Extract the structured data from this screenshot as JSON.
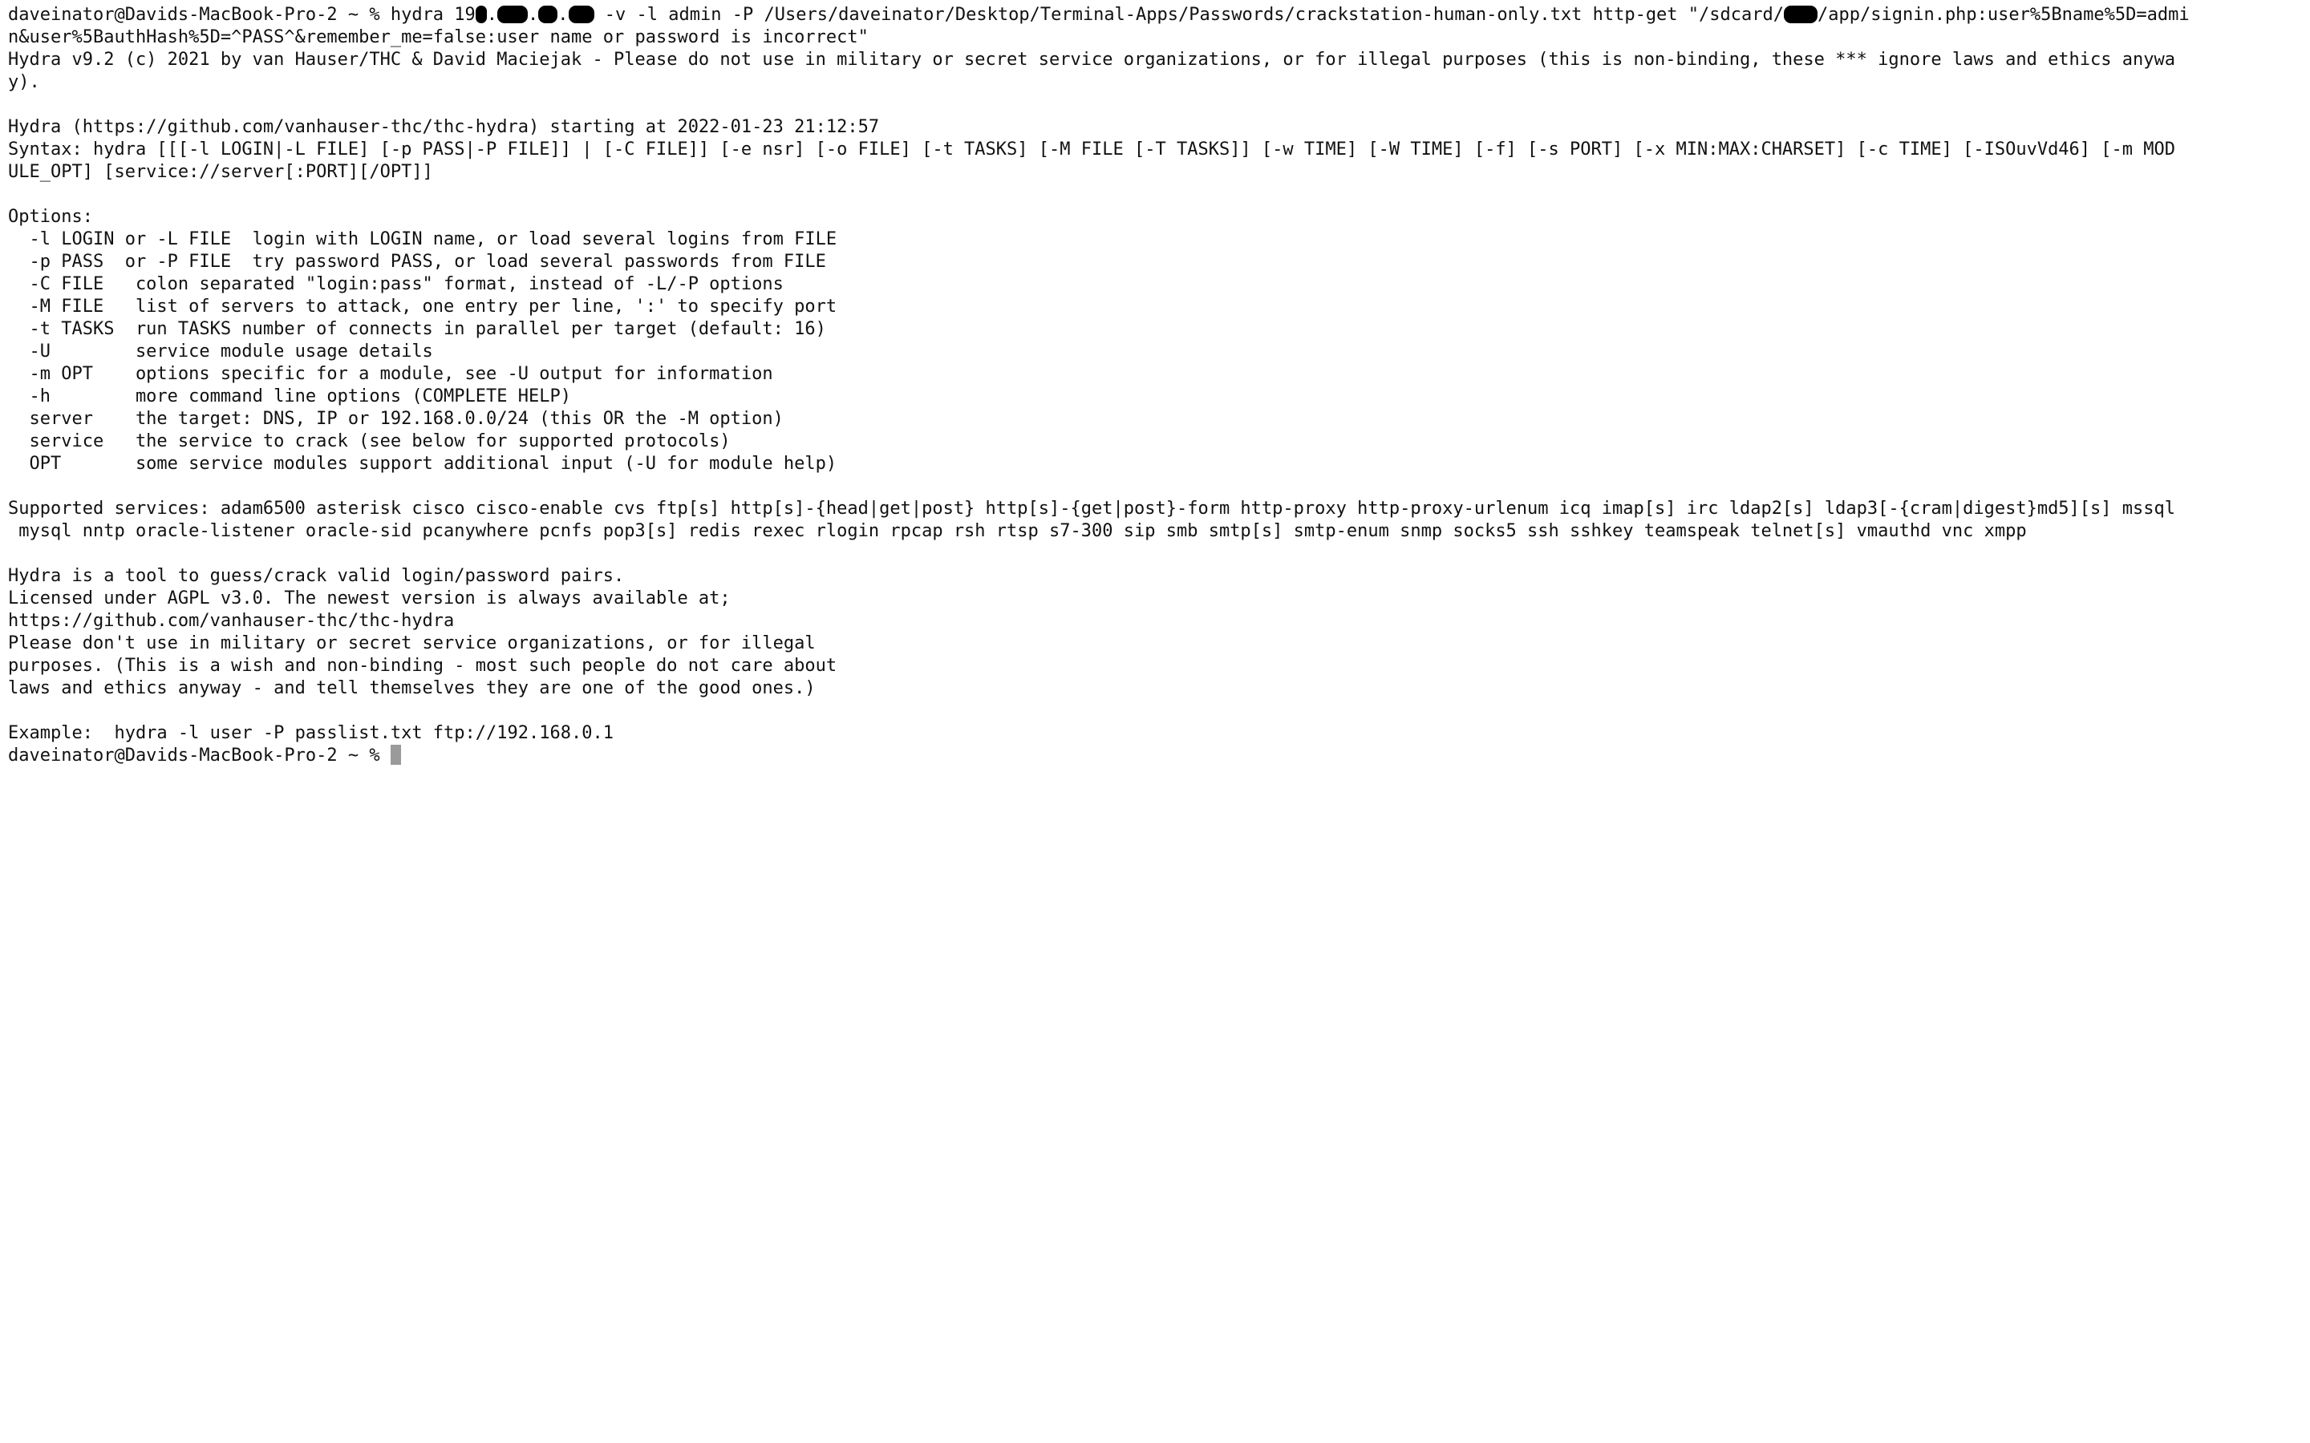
{
  "terminal": {
    "cmd": {
      "prompt": "daveinator@Davids-MacBook-Pro-2 ~ % ",
      "part1": "hydra 19",
      "part2": ".",
      "part3": ".",
      "part4": ".",
      "part5": " -v -l admin -P /Users/daveinator/Desktop/Terminal-Apps/Passwords/crackstation-human-only.txt http-get \"/sdcard/",
      "part6": "/app/signin.php:user%5Bname%5D=admi",
      "wrap1": "n&user%5BauthHash%5D=^PASS^&remember_me=false:user name or password is incorrect\""
    },
    "output": [
      "Hydra v9.2 (c) 2021 by van Hauser/THC & David Maciejak - Please do not use in military or secret service organizations, or for illegal purposes (this is non-binding, these *** ignore laws and ethics anywa",
      "y).",
      "",
      "Hydra (https://github.com/vanhauser-thc/thc-hydra) starting at 2022-01-23 21:12:57",
      "Syntax: hydra [[[-l LOGIN|-L FILE] [-p PASS|-P FILE]] | [-C FILE]] [-e nsr] [-o FILE] [-t TASKS] [-M FILE [-T TASKS]] [-w TIME] [-W TIME] [-f] [-s PORT] [-x MIN:MAX:CHARSET] [-c TIME] [-ISOuvVd46] [-m MOD",
      "ULE_OPT] [service://server[:PORT][/OPT]]",
      "",
      "Options:",
      "  -l LOGIN or -L FILE  login with LOGIN name, or load several logins from FILE",
      "  -p PASS  or -P FILE  try password PASS, or load several passwords from FILE",
      "  -C FILE   colon separated \"login:pass\" format, instead of -L/-P options",
      "  -M FILE   list of servers to attack, one entry per line, ':' to specify port",
      "  -t TASKS  run TASKS number of connects in parallel per target (default: 16)",
      "  -U        service module usage details",
      "  -m OPT    options specific for a module, see -U output for information",
      "  -h        more command line options (COMPLETE HELP)",
      "  server    the target: DNS, IP or 192.168.0.0/24 (this OR the -M option)",
      "  service   the service to crack (see below for supported protocols)",
      "  OPT       some service modules support additional input (-U for module help)",
      "",
      "Supported services: adam6500 asterisk cisco cisco-enable cvs ftp[s] http[s]-{head|get|post} http[s]-{get|post}-form http-proxy http-proxy-urlenum icq imap[s] irc ldap2[s] ldap3[-{cram|digest}md5][s] mssql",
      " mysql nntp oracle-listener oracle-sid pcanywhere pcnfs pop3[s] redis rexec rlogin rpcap rsh rtsp s7-300 sip smb smtp[s] smtp-enum snmp socks5 ssh sshkey teamspeak telnet[s] vmauthd vnc xmpp",
      "",
      "Hydra is a tool to guess/crack valid login/password pairs.",
      "Licensed under AGPL v3.0. The newest version is always available at;",
      "https://github.com/vanhauser-thc/thc-hydra",
      "Please don't use in military or secret service organizations, or for illegal",
      "purposes. (This is a wish and non-binding - most such people do not care about",
      "laws and ethics anyway - and tell themselves they are one of the good ones.)",
      "",
      "Example:  hydra -l user -P passlist.txt ftp://192.168.0.1"
    ],
    "final_prompt": "daveinator@Davids-MacBook-Pro-2 ~ % "
  }
}
